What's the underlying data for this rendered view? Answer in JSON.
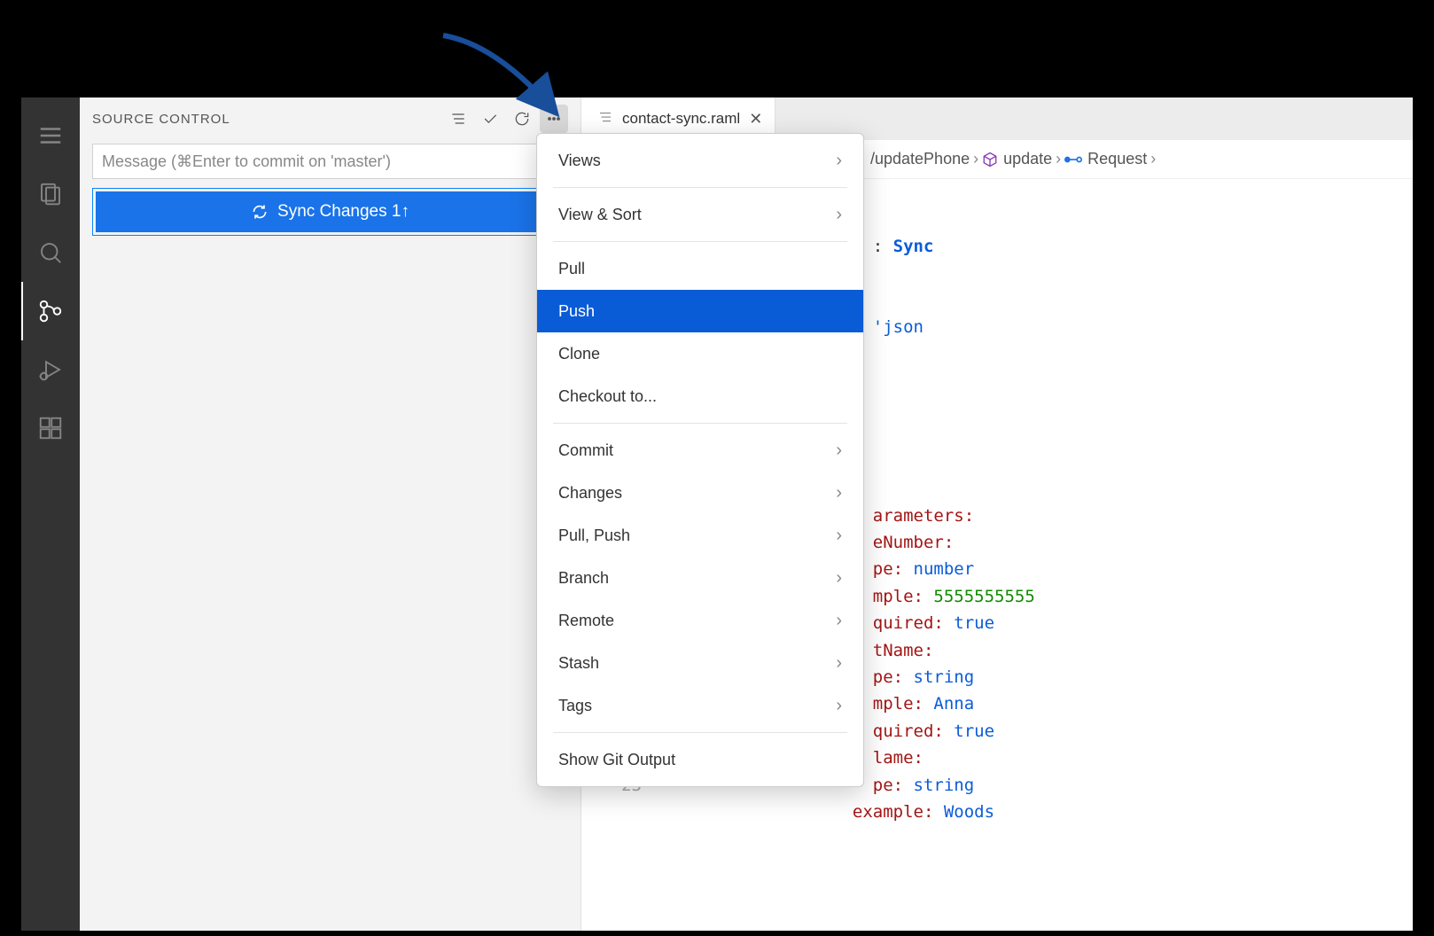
{
  "sidebar": {
    "title": "SOURCE CONTROL",
    "commit_placeholder": "Message (⌘Enter to commit on 'master')",
    "sync_label": "Sync Changes 1↑"
  },
  "tab": {
    "filename": "contact-sync.raml"
  },
  "breadcrumb": {
    "path1": "/updatePhone",
    "path2": "update",
    "path3": "Request"
  },
  "menu": {
    "views": "Views",
    "view_sort": "View & Sort",
    "pull": "Pull",
    "push": "Push",
    "clone": "Clone",
    "checkout": "Checkout to...",
    "commit": "Commit",
    "changes": "Changes",
    "pull_push": "Pull, Push",
    "branch": "Branch",
    "remote": "Remote",
    "stash": "Stash",
    "tags": "Tags",
    "show_output": "Show Git Output"
  },
  "code": {
    "title_val": "Sync",
    "json_suffix": "json",
    "params": "arameters:",
    "num_label": "eNumber:",
    "type_lbl": "pe: ",
    "type_number": "number",
    "example_lbl": "mple: ",
    "example_num": "5555555555",
    "required_lbl": "quired: ",
    "true": "true",
    "name_lbl": "tName:",
    "type_string": "string",
    "example_anna": "Anna",
    "lame": "lame:",
    "example_full": "example: ",
    "woods": "Woods",
    "line23": "23"
  }
}
